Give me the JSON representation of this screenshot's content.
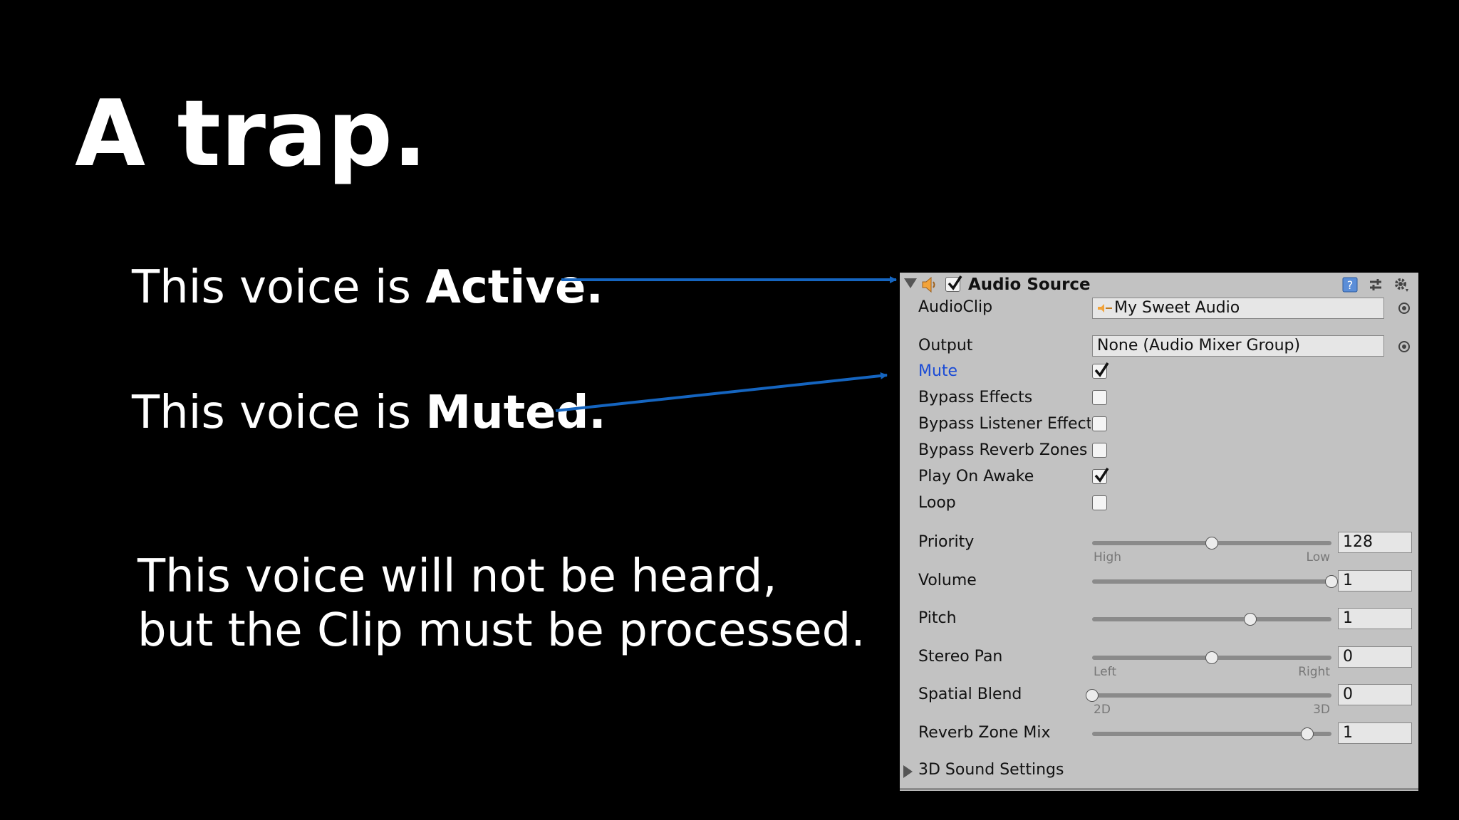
{
  "slide": {
    "title": "A trap.",
    "active_prefix": "This voice is ",
    "active_bold": "Active.",
    "muted_prefix": "This voice is ",
    "muted_bold": "Muted.",
    "para_line1": "This voice will not be heard,",
    "para_line2": "but the Clip must be processed."
  },
  "colors": {
    "arrow": "#1565c0",
    "panel": "#c2c2c2",
    "mute_label": "#1a4bd6"
  },
  "inspector": {
    "component_title": "Audio Source",
    "enabled": true,
    "audioclip": {
      "label": "AudioClip",
      "value": "My Sweet Audio"
    },
    "output": {
      "label": "Output",
      "value": "None (Audio Mixer Group)"
    },
    "toggles": [
      {
        "label": "Mute",
        "checked": true,
        "highlighted": true
      },
      {
        "label": "Bypass Effects",
        "checked": false
      },
      {
        "label": "Bypass Listener Effects",
        "checked": false
      },
      {
        "label": "Bypass Reverb Zones",
        "checked": false
      },
      {
        "label": "Play On Awake",
        "checked": true
      },
      {
        "label": "Loop",
        "checked": false
      }
    ],
    "sliders": [
      {
        "label": "Priority",
        "value": "128",
        "fraction": 0.5,
        "left_tick": "High",
        "right_tick": "Low"
      },
      {
        "label": "Volume",
        "value": "1",
        "fraction": 1.0
      },
      {
        "label": "Pitch",
        "value": "1",
        "fraction": 0.66
      },
      {
        "label": "Stereo Pan",
        "value": "0",
        "fraction": 0.5,
        "left_tick": "Left",
        "right_tick": "Right"
      },
      {
        "label": "Spatial Blend",
        "value": "0",
        "fraction": 0.0,
        "left_tick": "2D",
        "right_tick": "3D"
      },
      {
        "label": "Reverb Zone Mix",
        "value": "1",
        "fraction": 0.9
      }
    ],
    "foldout": "3D Sound Settings",
    "icons": [
      "fold-arrow-icon",
      "speaker-icon",
      "help-book-icon",
      "preset-icon",
      "gear-icon"
    ]
  }
}
